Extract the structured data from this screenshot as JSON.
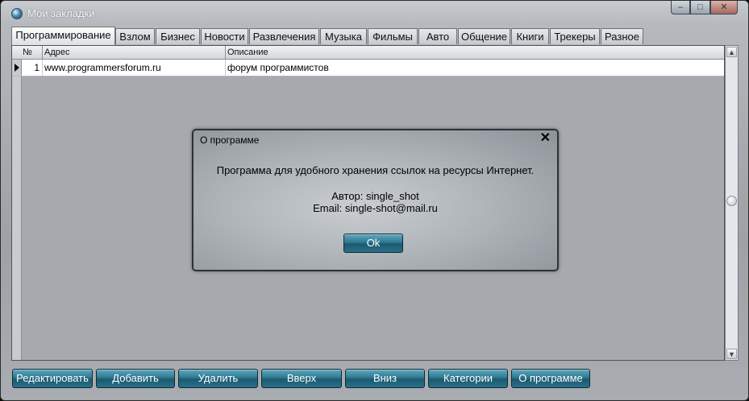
{
  "window": {
    "title": "Мои закладки"
  },
  "tabs": [
    {
      "label": "Программирование",
      "active": true
    },
    {
      "label": "Взлом"
    },
    {
      "label": "Бизнес"
    },
    {
      "label": "Новости"
    },
    {
      "label": "Развлечения"
    },
    {
      "label": "Музыка"
    },
    {
      "label": "Фильмы"
    },
    {
      "label": "Авто"
    },
    {
      "label": "Общение"
    },
    {
      "label": "Книги"
    },
    {
      "label": "Трекеры"
    },
    {
      "label": "Разное"
    }
  ],
  "grid": {
    "columns": [
      "№",
      "Адрес",
      "Описание"
    ],
    "rows": [
      {
        "num": "1",
        "address": "www.programmersforum.ru",
        "description": "форум программистов"
      }
    ]
  },
  "buttons": {
    "edit": "Редактировать",
    "add": "Добавить",
    "delete": "Удалить",
    "up": "Вверх",
    "down": "Вниз",
    "categories": "Категории",
    "about": "О программе"
  },
  "dialog": {
    "title": "О программе",
    "message": "Программа для удобного хранения ссылок на ресурсы Интернет.",
    "author": "Автор: single_shot",
    "email": "Email: single-shot@mail.ru",
    "ok_label": "Ok"
  },
  "colors": {
    "button_accent": "#2f7891",
    "window_background": "#a6aaaf"
  }
}
